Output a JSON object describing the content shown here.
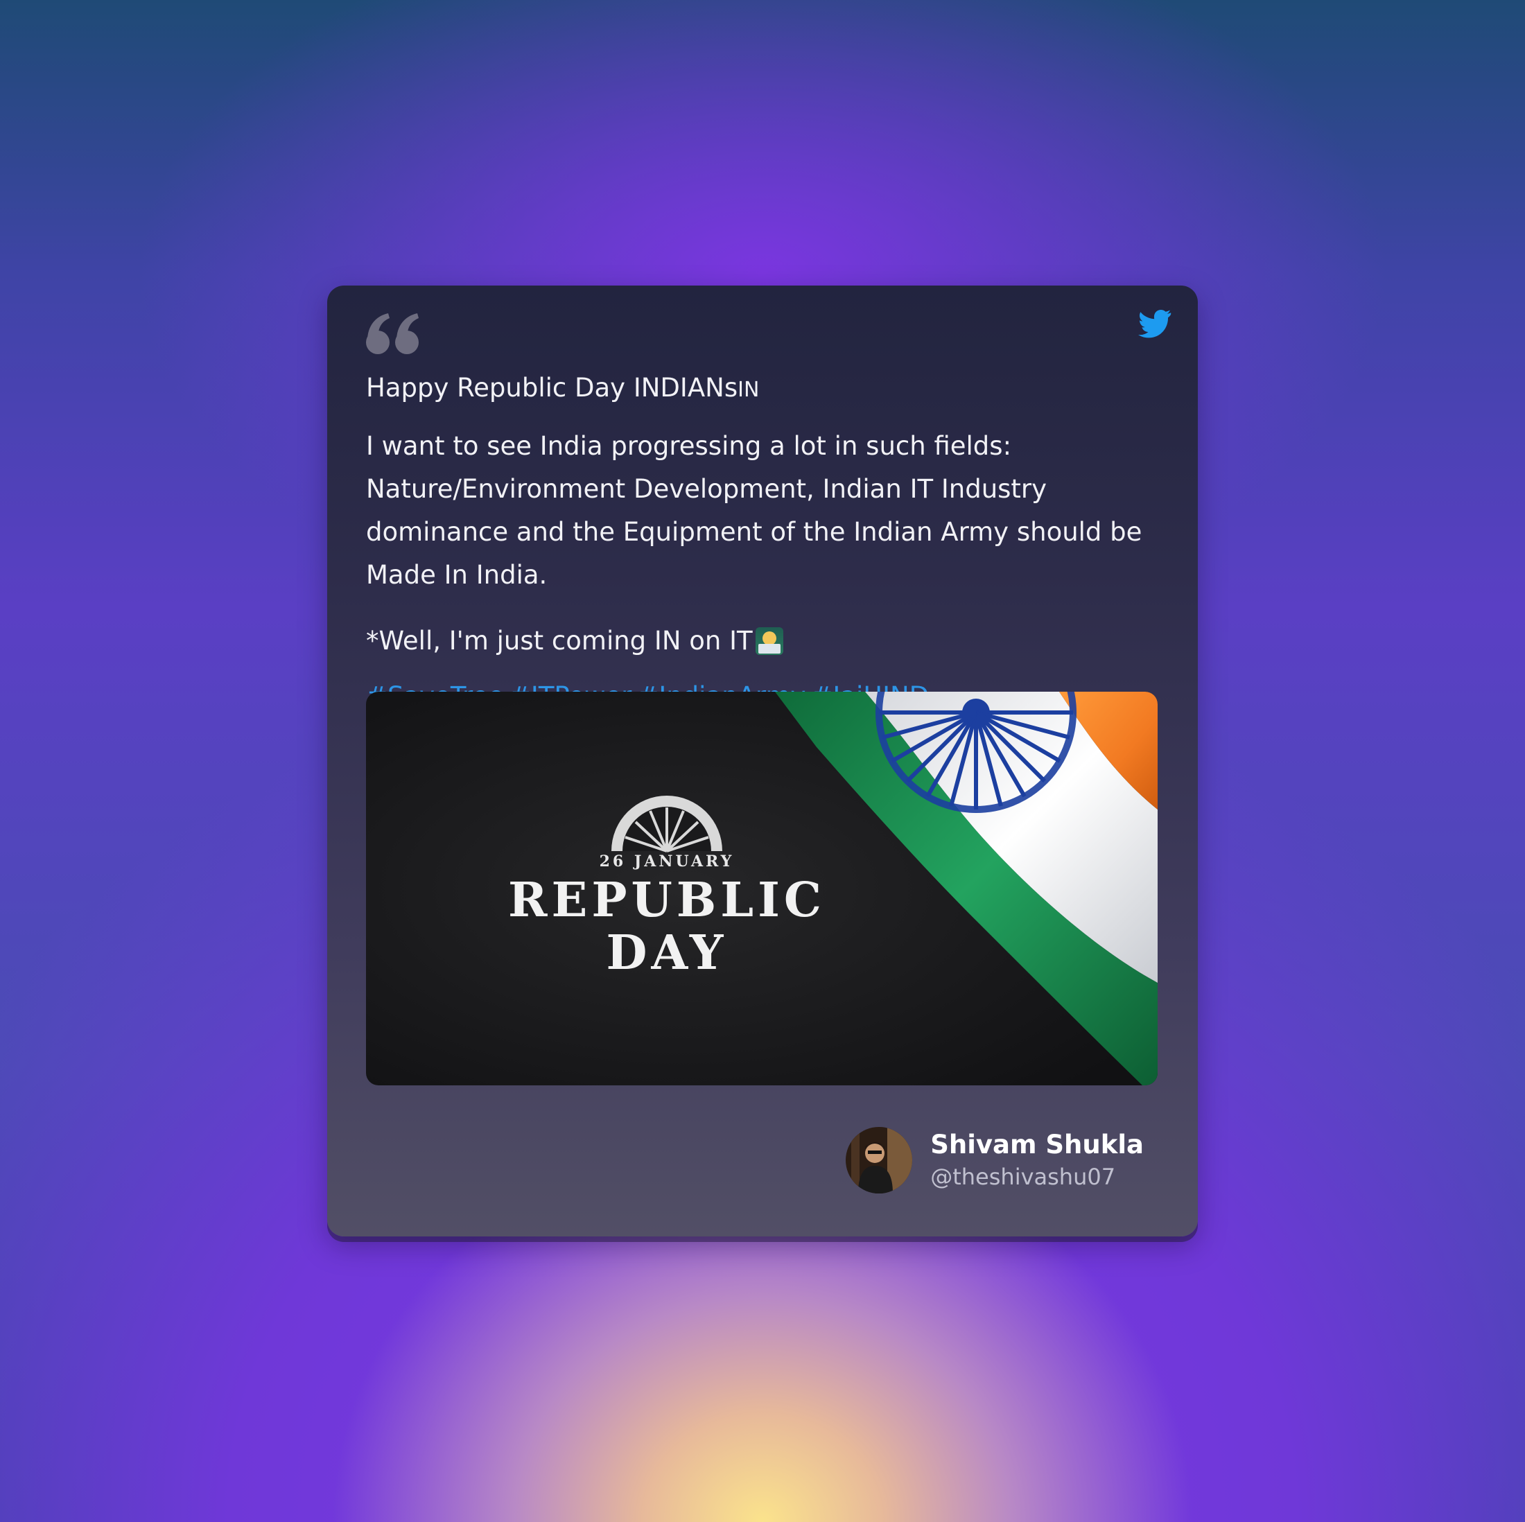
{
  "tweet": {
    "line1_prefix": "Happy Republic Day INDIANs",
    "line1_suffix": "IN",
    "body": "I want to see India progressing a lot in such fields: Nature/Environment Development, Indian IT Industry dominance and the Equipment of the Indian Army should be Made In India.",
    "footnote": "*Well, I'm just coming IN on IT",
    "footnote_emoji": "technologist-emoji",
    "hashtags": [
      "#SaveTree",
      "#ITPower",
      "#IndianArmy",
      "#JaiHIND"
    ]
  },
  "image": {
    "date_text": "26 JANUARY",
    "title_line1": "REPUBLIC",
    "title_line2": "DAY"
  },
  "author": {
    "name": "Shivam Shukla",
    "handle": "@theshivashu07"
  },
  "colors": {
    "hashtag": "#2d95e6",
    "twitter_blue": "#1d9bf0",
    "quote_gray": "#6e6d80",
    "flag_saffron": "#f27a22",
    "flag_green": "#138a4c",
    "flag_chakra": "#1c3fa0"
  },
  "icons": {
    "quote": "quote-icon",
    "twitter": "twitter-bird-icon"
  }
}
